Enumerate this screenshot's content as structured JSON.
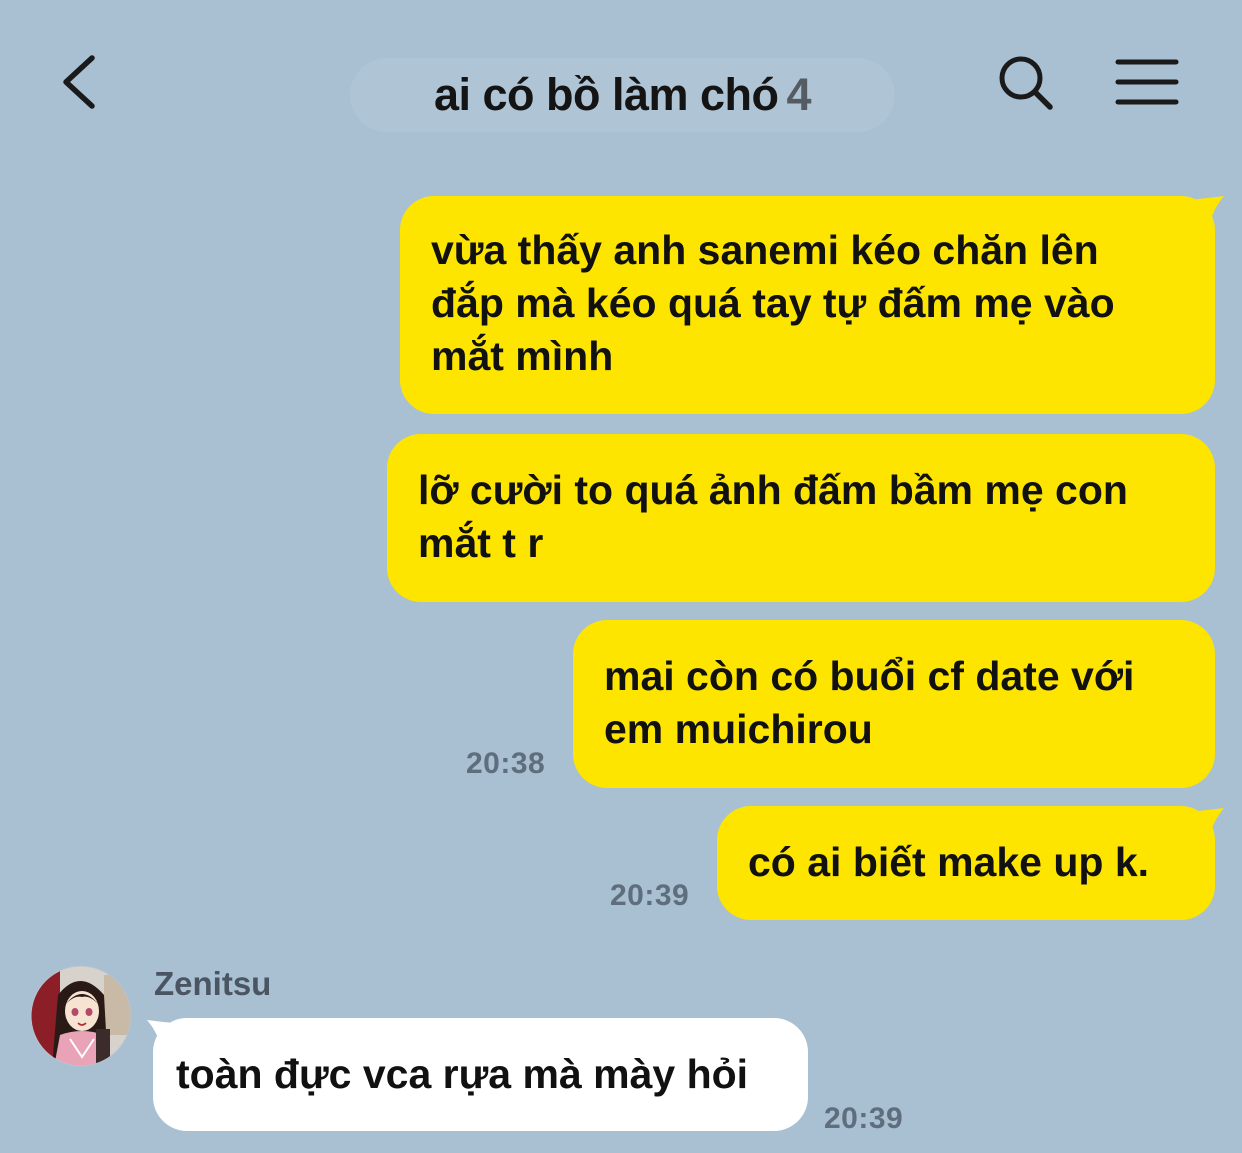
{
  "header": {
    "title": "ai có bồ làm chó",
    "member_count": "4",
    "back_icon": "chevron-left-icon",
    "search_icon": "search-icon",
    "menu_icon": "menu-icon"
  },
  "messages": [
    {
      "direction": "outgoing",
      "lines": [
        "vừa thấy anh sanemi kéo chăn lên",
        "đắp mà kéo quá tay tự đấm mẹ vào",
        "mắt mình"
      ],
      "time": ""
    },
    {
      "direction": "outgoing",
      "lines": [
        "lỡ cười to quá ảnh đấm bầm mẹ con",
        "mắt t r"
      ],
      "time": ""
    },
    {
      "direction": "outgoing",
      "lines": [
        "mai còn có buổi cf date với",
        "em muichirou"
      ],
      "time": "20:38"
    },
    {
      "direction": "outgoing",
      "lines": [
        "có ai biết make up k."
      ],
      "time": "20:39"
    },
    {
      "direction": "incoming",
      "sender": "Zenitsu",
      "lines": [
        "toàn đực vca rựa mà mày hỏi"
      ],
      "time": "20:39"
    }
  ],
  "colors": {
    "background": "#a9bfd2",
    "outgoing_bubble": "#fee500",
    "incoming_bubble": "#ffffff"
  }
}
